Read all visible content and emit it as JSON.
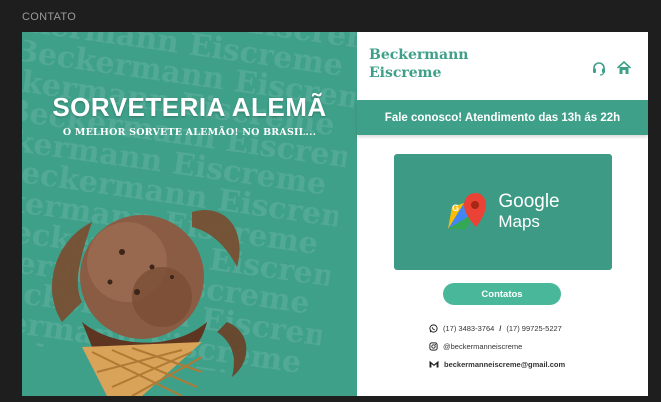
{
  "frame": {
    "label": "CONTATO"
  },
  "hero": {
    "title": "SORVETERIA ALEMÃ",
    "subtitle": "O MELHOR SORVETE ALEMÃO! NO BRASIL...",
    "watermark_text": "Beckermann Eiscreme"
  },
  "brand": {
    "line1": "Beckermann",
    "line2": "Eiscreme"
  },
  "header_icons": [
    "headset-icon",
    "home-icon"
  ],
  "banner": {
    "text": "Fale conosco! Atendimento das 13h ás 22h"
  },
  "maps": {
    "line1": "Google",
    "line2": "Maps"
  },
  "contact_button": {
    "label": "Contatos"
  },
  "contacts": {
    "phone1": "(17) 3483-3764",
    "separator": "/",
    "phone2": "(17) 99725-5227",
    "instagram": "@beckermanneiscreme",
    "email": "beckermanneiscreme@gmail.com"
  },
  "colors": {
    "primary": "#3fa08a",
    "button": "#49b89a",
    "background": "#1e1e1e"
  }
}
